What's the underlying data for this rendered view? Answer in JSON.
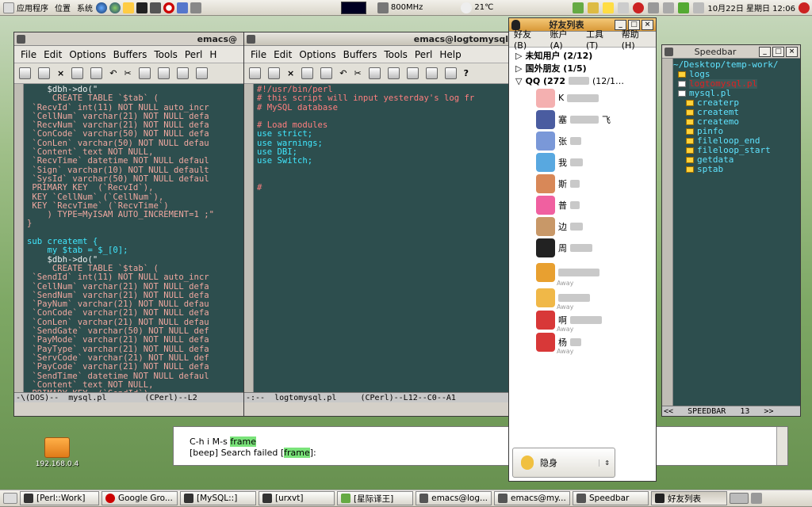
{
  "top_panel": {
    "menus": [
      "应用程序",
      "位置",
      "系统"
    ],
    "cpu": "800MHz",
    "weather": "21℃",
    "clock": "10月22日 星期日 12:06"
  },
  "desktop": {
    "icon_label": "192.168.0.4"
  },
  "emacs_left": {
    "menu": [
      "File",
      "Edit",
      "Options",
      "Buffers",
      "Tools",
      "Perl",
      "H"
    ],
    "lines": [
      "    $dbh->do(\"",
      "     CREATE TABLE `$tab` (",
      " `RecvId` int(11) NOT NULL auto_incr",
      " `CellNum` varchar(21) NOT NULL defa",
      " `RecvNum` varchar(21) NOT NULL defa",
      " `ConCode` varchar(50) NOT NULL defa",
      " `ConLen` varchar(50) NOT NULL defau",
      " `Content` text NOT NULL,",
      " `RecvTime` datetime NOT NULL defaul",
      " `Sign` varchar(10) NOT NULL default",
      " `SysId` varchar(50) NOT NULL defaul",
      " PRIMARY KEY  (`RecvId`),",
      " KEY `CellNum` (`CellNum`),",
      " KEY `RecvTime` (`RecvTime`)",
      "    ) TYPE=MyISAM AUTO_INCREMENT=1 ;\"",
      "}",
      "",
      "sub createmt {",
      "    my $tab = $_[0];",
      "    $dbh->do(\"",
      "     CREATE TABLE `$tab` (",
      " `SendId` int(11) NOT NULL auto_incr",
      " `CellNum` varchar(21) NOT NULL defa",
      " `SendNum` varchar(21) NOT NULL defa",
      " `PayNum` varchar(21) NOT NULL defau",
      " `ConCode` varchar(21) NOT NULL defa",
      " `ConLen` varchar(21) NOT NULL defau",
      " `SendGate` varchar(50) NOT NULL def",
      " `PayMode` varchar(21) NOT NULL defa",
      " `PayType` varchar(21) NOT NULL defa",
      " `ServCode` varchar(21) NOT NULL def",
      " `PayCode` varchar(21) NOT NULL defa",
      " `SendTime` datetime NOT NULL defaul",
      " `Content` text NOT NULL,",
      " PRIMARY KEY  (`SendId`),"
    ],
    "modeline": "-\\(DOS)--  mysql.pl        (CPerl)--L2"
  },
  "emacs_mid": {
    "title": "emacs@logtomysql",
    "menu": [
      "File",
      "Edit",
      "Options",
      "Buffers",
      "Tools",
      "Perl",
      "Help"
    ],
    "lines": [
      "#!/usr/bin/perl",
      "# this script will input yesterday's log fr",
      "# MySQL database",
      "",
      "# Load modules",
      "use strict;",
      "use warnings;",
      "use DBI;",
      "use Switch;",
      "",
      "",
      "#"
    ],
    "modeline": "-:--  logtomysql.pl     (CPerl)--L12--C0--A1"
  },
  "left_title": "emacs@",
  "minibuffer": {
    "line1": "C-h i M-s",
    "frame_word": "frame",
    "line2": "[beep] Search failed [",
    "line2_word": "frame",
    "line2_end": "]:"
  },
  "qq": {
    "title": "好友列表",
    "menu": [
      "好友(B)",
      "账户(A)",
      "工具(T)",
      "帮助(H)"
    ],
    "groups": [
      "未知用户 (2/12)",
      "国外朋友 (1/5)",
      "QQ (272",
      "(12/1…"
    ],
    "contacts": [
      "K",
      "塞",
      "飞",
      "张",
      "我",
      "斯",
      "普",
      "边",
      "周",
      "",
      "",
      "",
      "",
      "",
      "",
      "啊",
      "杨"
    ],
    "away": "Away",
    "status": "隐身",
    "colors": {
      "avatar1": "#e8a0a0",
      "avatar2": "#5060a0"
    }
  },
  "speedbar": {
    "title": "Speedbar",
    "path": "~/Desktop/temp-work/",
    "entries": [
      "logs",
      "logtomysql.pl",
      "mysql.pl"
    ],
    "tags": [
      "createrp",
      "createmt",
      "createmo",
      "pinfo",
      "fileloop_end",
      "fileloop_start",
      "getdata",
      "sptab"
    ],
    "modeline": "<<   SPEEDBAR   13   >>"
  },
  "taskbar": [
    "[Perl::Work]",
    "Google Gro...",
    "[MySQL::]",
    "[urxvt]",
    "[星际译王]",
    "emacs@log...",
    "emacs@my...",
    "Speedbar",
    "好友列表"
  ]
}
